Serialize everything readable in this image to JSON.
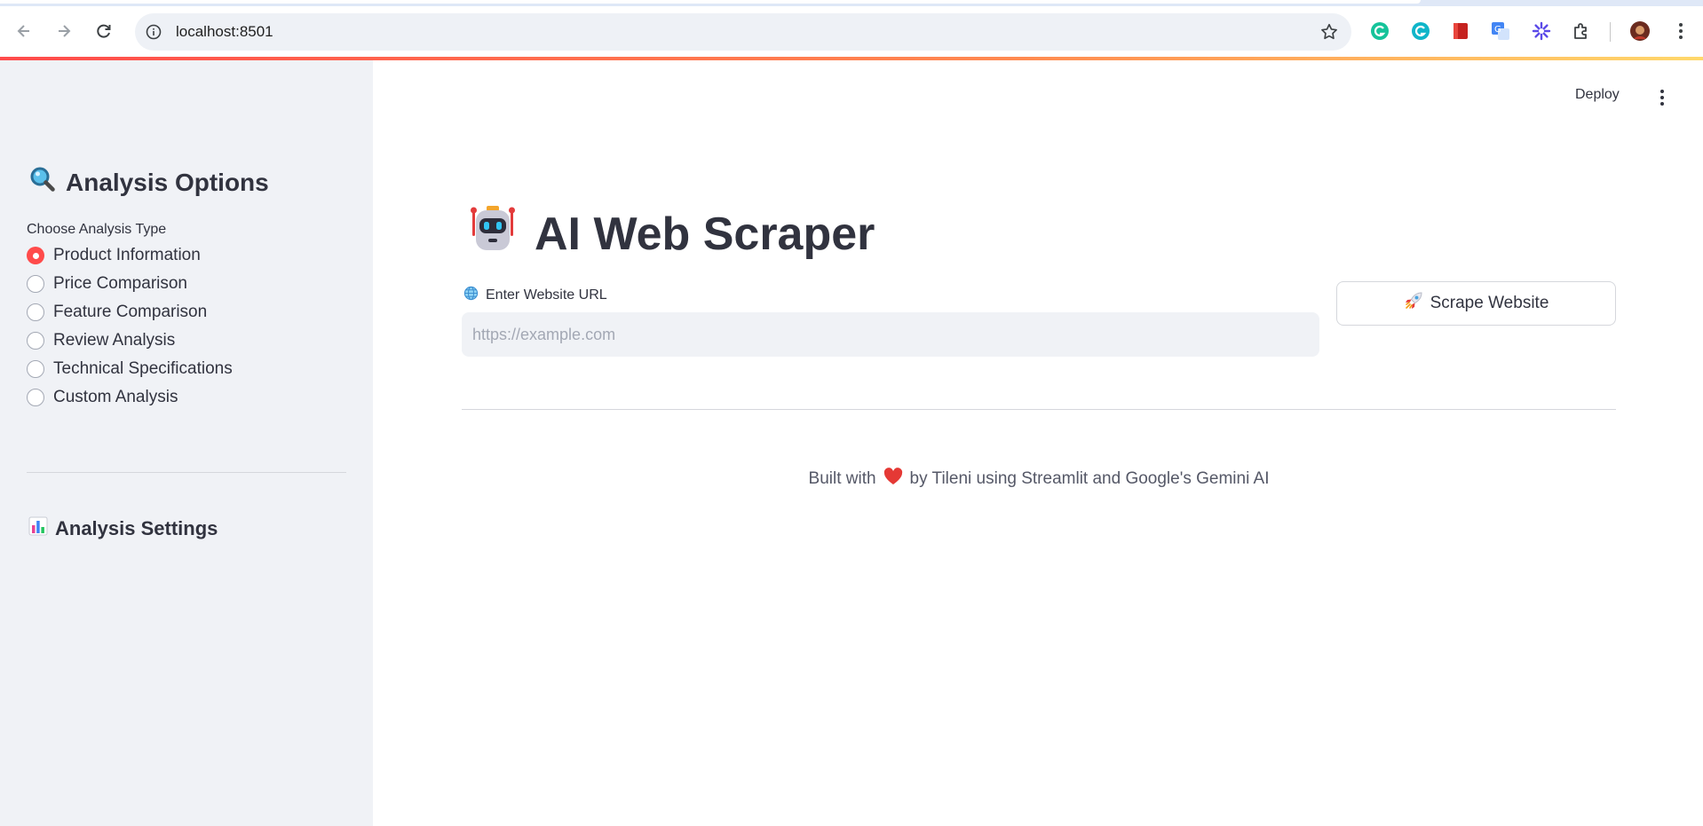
{
  "browser": {
    "url": "localhost:8501",
    "icons": [
      "back-arrow-icon",
      "forward-arrow-icon",
      "reload-icon",
      "site-info-icon",
      "bookmark-star-icon",
      "grammarly-icon",
      "grammarly-go-icon",
      "bookmark-extension-icon",
      "google-translate-icon",
      "snowflake-extension-icon",
      "extensions-puzzle-icon",
      "profile-avatar-icon",
      "browser-menu-icon"
    ]
  },
  "colors": {
    "accent": "#ff4b4b",
    "sidebar_bg": "#f0f2f6",
    "text": "#31333f"
  },
  "sidebar": {
    "title": "Analysis Options",
    "title_icon": "magnifier-icon",
    "radio_label": "Choose Analysis Type",
    "options": [
      {
        "label": "Product Information",
        "selected": true
      },
      {
        "label": "Price Comparison",
        "selected": false
      },
      {
        "label": "Feature Comparison",
        "selected": false
      },
      {
        "label": "Review Analysis",
        "selected": false
      },
      {
        "label": "Technical Specifications",
        "selected": false
      },
      {
        "label": "Custom Analysis",
        "selected": false
      }
    ],
    "settings_title": "Analysis Settings",
    "settings_icon": "bar-chart-icon"
  },
  "header": {
    "deploy_label": "Deploy"
  },
  "main": {
    "title": "AI Web Scraper",
    "title_icon": "robot-icon",
    "url_label": "Enter Website URL",
    "url_label_icon": "globe-icon",
    "url_placeholder": "https://example.com",
    "url_value": "",
    "scrape_button_label": "Scrape Website",
    "scrape_button_icon": "rocket-icon",
    "footer_prefix": "Built with",
    "footer_icon": "heart-icon",
    "footer_suffix": "by Tileni using Streamlit and Google's Gemini AI"
  }
}
